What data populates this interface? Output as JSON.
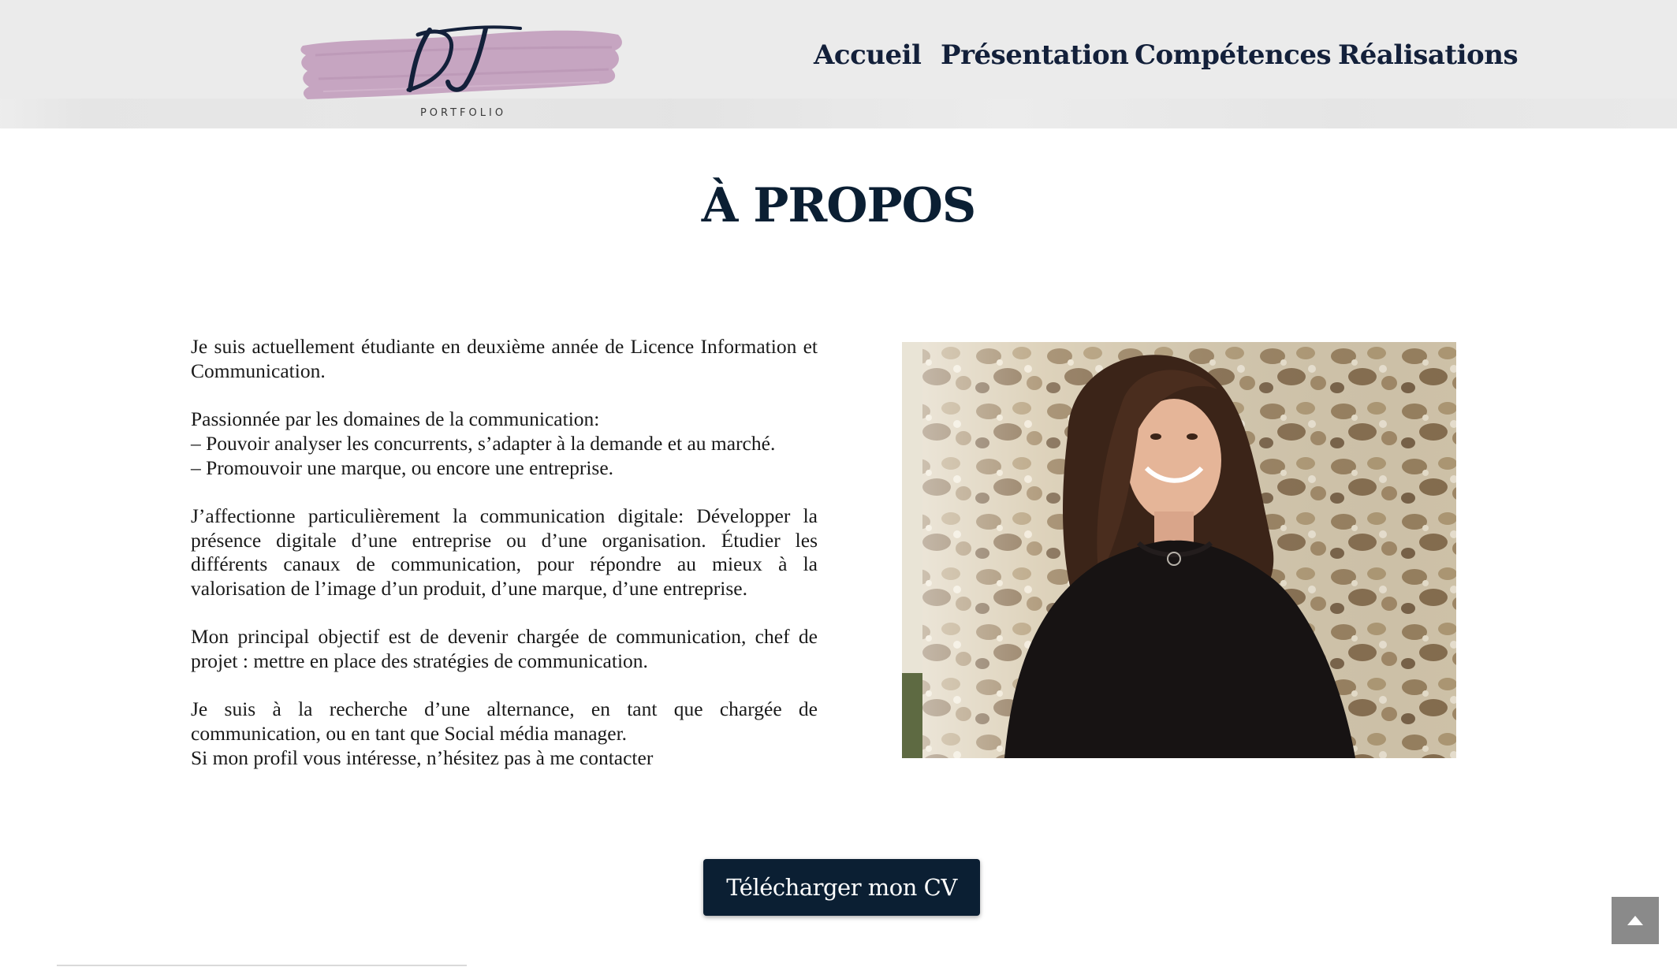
{
  "logo": {
    "initials": "DJ",
    "subtitle": "PORTFOLIO"
  },
  "nav": {
    "items": [
      {
        "label": "Accueil"
      },
      {
        "label": "Présentation"
      },
      {
        "label": "Compétences"
      },
      {
        "label": "Réalisations"
      }
    ]
  },
  "main": {
    "title": "À PROPOS",
    "paragraphs": [
      {
        "lines": [
          "Je suis actuellement étudiante en deuxième année de Licence Information et Communication."
        ]
      },
      {
        "lines": [
          "Passionnée par les domaines de la communication:",
          "– Pouvoir analyser les concurrents, s’adapter à la demande et au marché.",
          "– Promouvoir une marque, ou encore une entreprise."
        ]
      },
      {
        "lines": [
          "J’affectionne particulièrement la communication digitale: Développer la présence digitale d’une entreprise ou d’une organisation. Étudier les différents canaux de communication, pour répondre au mieux à la valorisation de l’image d’un produit, d’une marque, d’une entreprise."
        ]
      },
      {
        "lines": [
          "Mon principal objectif est de devenir chargée de communication, chef de projet : mettre en place des stratégies de communication."
        ]
      },
      {
        "lines": [
          "Je suis à la recherche d’une alternance, en tant que chargée de communication, ou en tant que Social média manager.",
          "Si mon profil vous intéresse, n’hésitez pas à me contacter"
        ]
      }
    ],
    "cv_button": "Télécharger mon CV"
  },
  "icons": {
    "scroll_top": "chevron-up-icon"
  },
  "colors": {
    "header_bg": "#ebebeb",
    "navy": "#0b1f33",
    "logo_brush": "#c6a5c1",
    "scroll_button": "#8a8a8a"
  }
}
